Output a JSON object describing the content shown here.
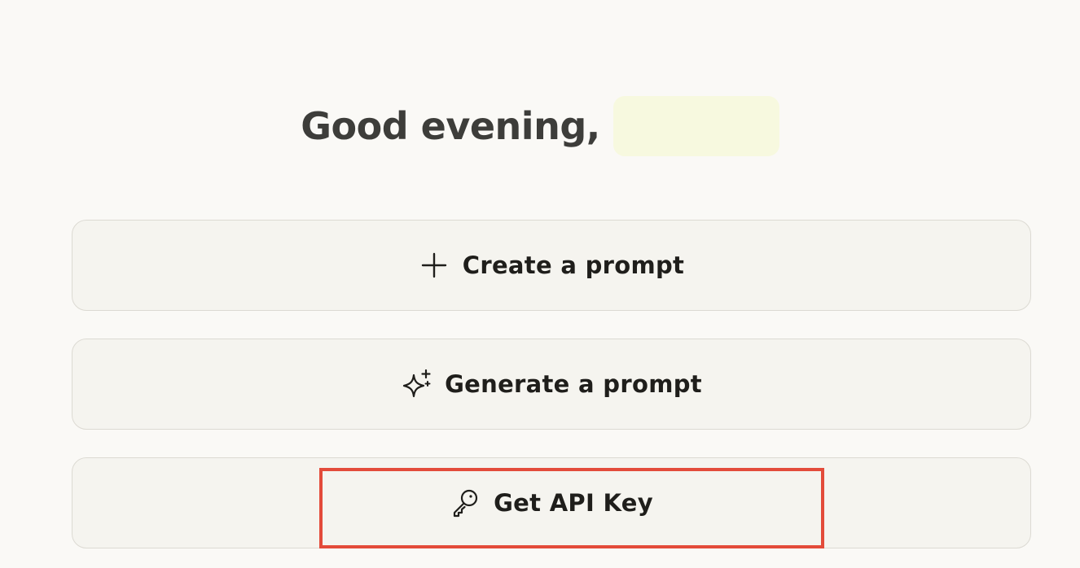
{
  "greeting": {
    "text": "Good evening,"
  },
  "actions": [
    {
      "label": "Create a prompt",
      "icon": "plus-icon"
    },
    {
      "label": "Generate a prompt",
      "icon": "sparkle-icon"
    },
    {
      "label": "Get API Key",
      "icon": "key-icon"
    }
  ],
  "colors": {
    "highlight": "#e34b3a",
    "name_redaction": "#f7f9df"
  }
}
